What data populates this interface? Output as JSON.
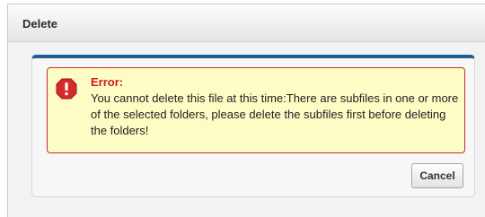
{
  "dialog": {
    "title": "Delete"
  },
  "error": {
    "icon": "error-octagon-icon",
    "title": "Error:",
    "message": "You cannot delete this file at this time:There are subfiles in one or more of the selected folders, please delete the subfiles first before deleting the folders!"
  },
  "buttons": {
    "cancel_label": "Cancel"
  },
  "colors": {
    "accent": "#1f5d96",
    "error_red": "#cc1f1f",
    "error_background": "#fdfcc4"
  }
}
